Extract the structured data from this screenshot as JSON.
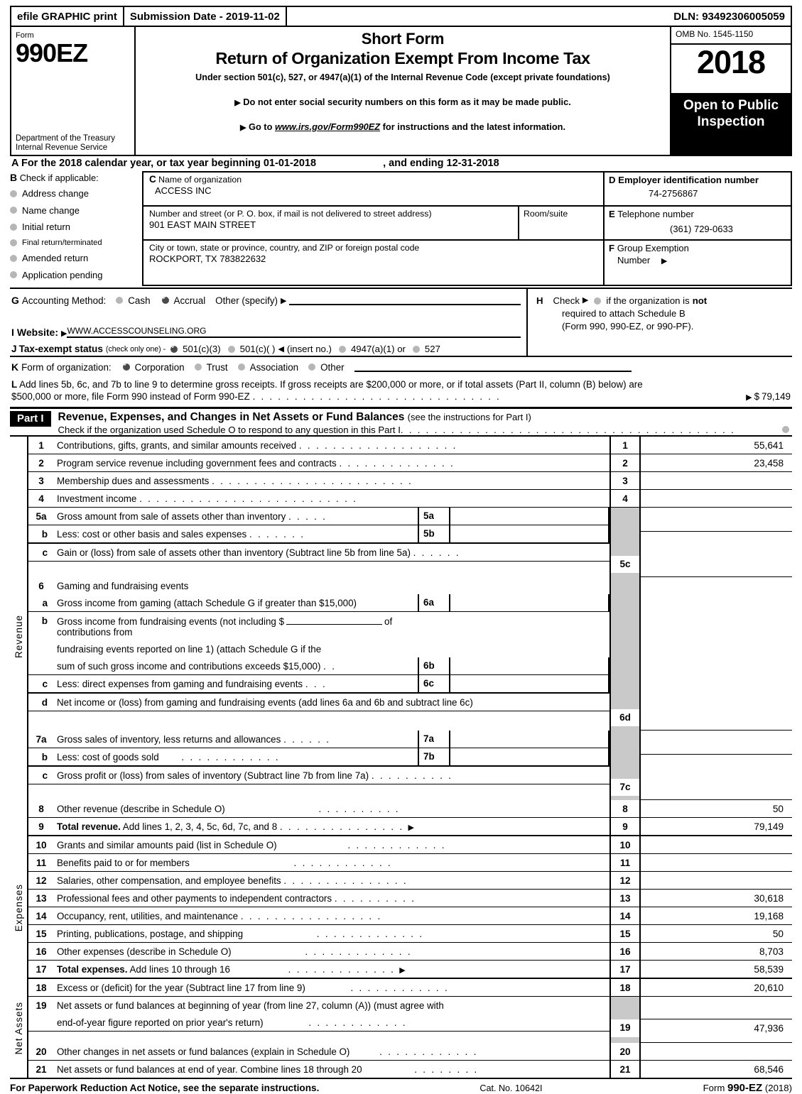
{
  "efile": {
    "graphic_print": "efile GRAPHIC print",
    "submission_date": "Submission Date - 2019-11-02",
    "dln": "DLN: 93492306005059"
  },
  "masthead": {
    "form_label": "Form",
    "form_number": "990EZ",
    "department": "Department of the Treasury Internal Revenue Service",
    "title_line1": "Short Form",
    "title_line2": "Return of Organization Exempt From Income Tax",
    "under_section": "Under section 501(c), 527, or 4947(a)(1) of the Internal Revenue Code (except private foundations)",
    "bullet1": "Do not enter social security numbers on this form as it may be made public.",
    "bullet2_pre": "Go to ",
    "bullet2_link": "www.irs.gov/Form990EZ",
    "bullet2_post": " for instructions and the latest information.",
    "omb": "OMB No. 1545-1150",
    "year": "2018",
    "open_to_public": "Open to Public Inspection"
  },
  "line_a": {
    "letter": "A",
    "text_pre": "For the 2018 calendar year, or tax year beginning",
    "begin_date": "01-01-2018",
    "text_mid": ", and ending",
    "end_date": "12-31-2018"
  },
  "section_b": {
    "letter": "B",
    "heading": "Check if applicable:",
    "items": [
      {
        "label": "Address change",
        "checked": false
      },
      {
        "label": "Name change",
        "checked": false
      },
      {
        "label": "Initial return",
        "checked": false
      },
      {
        "label": "Final return/terminated",
        "checked": false
      },
      {
        "label": "Amended return",
        "checked": false
      },
      {
        "label": "Application pending",
        "checked": false
      }
    ]
  },
  "section_c": {
    "letter": "C",
    "name_label": "Name of organization",
    "name_value": "ACCESS INC",
    "street_label": "Number and street (or P. O. box, if mail is not delivered to street address)",
    "street_value": "901 EAST MAIN STREET",
    "room_label": "Room/suite",
    "room_value": "",
    "city_label": "City or town, state or province, country, and ZIP or foreign postal code",
    "city_value": "ROCKPORT, TX   783822632"
  },
  "section_d": {
    "letter": "D",
    "label": "Employer identification number",
    "value": "74-2756867"
  },
  "section_e": {
    "letter": "E",
    "label": "Telephone number",
    "value": "(361) 729-0633"
  },
  "section_f": {
    "letter": "F",
    "label_line1": "Group Exemption",
    "label_line2": "Number",
    "value": ""
  },
  "section_g": {
    "letter": "G",
    "label": "Accounting Method:",
    "cash_label": "Cash",
    "cash_checked": false,
    "accrual_label": "Accrual",
    "accrual_checked": true,
    "other_label": "Other (specify)",
    "other_value": ""
  },
  "section_h": {
    "letter": "H",
    "text_pre": "Check",
    "checked": false,
    "text_line1": "if the organization is",
    "text_bold": "not",
    "text_line2": "required to attach Schedule B",
    "text_line3": "(Form 990, 990-EZ, or 990-PF)."
  },
  "section_i": {
    "letter": "I",
    "label": "Website:",
    "value": "WWW.ACCESSCOUNSELING.ORG"
  },
  "section_j": {
    "letter": "J",
    "label": "Tax-exempt status",
    "note": "(check only one) -",
    "options": [
      {
        "label": "501(c)(3)",
        "checked": true
      },
      {
        "label": "501(c)(  )",
        "checked": false
      },
      {
        "label": "4947(a)(1) or",
        "checked": false
      },
      {
        "label": "527",
        "checked": false
      }
    ],
    "insert_no": "(insert no.)"
  },
  "section_k": {
    "letter": "K",
    "label": "Form of organization:",
    "options": [
      {
        "label": "Corporation",
        "checked": true
      },
      {
        "label": "Trust",
        "checked": false
      },
      {
        "label": "Association",
        "checked": false
      },
      {
        "label": "Other",
        "checked": false
      }
    ]
  },
  "section_l": {
    "letter": "L",
    "text_line1": "Add lines 5b, 6c, and 7b to line 9 to determine gross receipts. If gross receipts are $200,000 or more, or if total assets (Part II, column (B) below) are",
    "text_line2": "$500,000 or more, file Form 990 instead of Form 990-EZ",
    "amount_prefix": "$",
    "amount": "79,149"
  },
  "part1": {
    "tag": "Part I",
    "title": "Revenue, Expenses, and Changes in Net Assets or Fund Balances",
    "title_note": "(see the instructions for Part I)",
    "schedule_o": "Check if the organization used Schedule O to respond to any question in this Part I",
    "schedule_o_checked": false
  },
  "sidebars": {
    "revenue": "Revenue",
    "expenses": "Expenses",
    "net_assets": "Net Assets"
  },
  "rows": {
    "r1": {
      "num": "1",
      "desc": "Contributions, gifts, grants, and similar amounts received",
      "code": "1",
      "amount": "55,641"
    },
    "r2": {
      "num": "2",
      "desc": "Program service revenue including government fees and contracts",
      "code": "2",
      "amount": "23,458"
    },
    "r3": {
      "num": "3",
      "desc": "Membership dues and assessments",
      "code": "3",
      "amount": ""
    },
    "r4": {
      "num": "4",
      "desc": "Investment income",
      "code": "4",
      "amount": ""
    },
    "r5a": {
      "num": "5a",
      "desc": "Gross amount from sale of assets other than inventory",
      "box": "5a",
      "amount": ""
    },
    "r5b": {
      "num": "b",
      "desc": "Less: cost or other basis and sales expenses",
      "box": "5b",
      "amount": ""
    },
    "r5c": {
      "num": "c",
      "desc": "Gain or (loss) from sale of assets other than inventory (Subtract line 5b from line 5a)",
      "code": "5c",
      "amount": ""
    },
    "r6": {
      "num": "6",
      "desc": "Gaming and fundraising events"
    },
    "r6a": {
      "num": "a",
      "desc": "Gross income from gaming (attach Schedule G if greater than $15,000)",
      "box": "6a",
      "amount": ""
    },
    "r6b": {
      "num": "b",
      "desc_l1_pre": "Gross income from fundraising events (not including $",
      "desc_l1_post": "of contributions from",
      "desc_l2": "fundraising events reported on line 1) (attach Schedule G if the",
      "desc_l3": "sum of such gross income and contributions exceeds $15,000)",
      "box": "6b",
      "amount": ""
    },
    "r6c": {
      "num": "c",
      "desc": "Less: direct expenses from gaming and fundraising events",
      "box": "6c",
      "amount": ""
    },
    "r6d": {
      "num": "d",
      "desc": "Net income or (loss) from gaming and fundraising events (add lines 6a and 6b and subtract line 6c)",
      "code": "6d",
      "amount": ""
    },
    "r7a": {
      "num": "7a",
      "desc": "Gross sales of inventory, less returns and allowances",
      "box": "7a",
      "amount": ""
    },
    "r7b": {
      "num": "b",
      "desc": "Less: cost of goods sold",
      "box": "7b",
      "amount": ""
    },
    "r7c": {
      "num": "c",
      "desc": "Gross profit or (loss) from sales of inventory (Subtract line 7b from line 7a)",
      "code": "7c",
      "amount": ""
    },
    "r8": {
      "num": "8",
      "desc": "Other revenue (describe in Schedule O)",
      "code": "8",
      "amount": "50"
    },
    "r9": {
      "num": "9",
      "desc_bold": "Total revenue.",
      "desc": "Add lines 1, 2, 3, 4, 5c, 6d, 7c, and 8",
      "code": "9",
      "amount": "79,149"
    },
    "r10": {
      "num": "10",
      "desc": "Grants and similar amounts paid (list in Schedule O)",
      "code": "10",
      "amount": ""
    },
    "r11": {
      "num": "11",
      "desc": "Benefits paid to or for members",
      "code": "11",
      "amount": ""
    },
    "r12": {
      "num": "12",
      "desc": "Salaries, other compensation, and employee benefits",
      "code": "12",
      "amount": ""
    },
    "r13": {
      "num": "13",
      "desc": "Professional fees and other payments to independent contractors",
      "code": "13",
      "amount": "30,618"
    },
    "r14": {
      "num": "14",
      "desc": "Occupancy, rent, utilities, and maintenance",
      "code": "14",
      "amount": "19,168"
    },
    "r15": {
      "num": "15",
      "desc": "Printing, publications, postage, and shipping",
      "code": "15",
      "amount": "50"
    },
    "r16": {
      "num": "16",
      "desc": "Other expenses (describe in Schedule O)",
      "code": "16",
      "amount": "8,703"
    },
    "r17": {
      "num": "17",
      "desc_bold": "Total expenses.",
      "desc": "Add lines 10 through 16",
      "code": "17",
      "amount": "58,539"
    },
    "r18": {
      "num": "18",
      "desc": "Excess or (deficit) for the year (Subtract line 17 from line 9)",
      "code": "18",
      "amount": "20,610"
    },
    "r19": {
      "num": "19",
      "desc_l1": "Net assets or fund balances at beginning of year (from line 27, column (A)) (must agree with",
      "desc_l2": "end-of-year figure reported on prior year's return)",
      "code": "19",
      "amount": "47,936"
    },
    "r20": {
      "num": "20",
      "desc": "Other changes in net assets or fund balances (explain in Schedule O)",
      "code": "20",
      "amount": ""
    },
    "r21": {
      "num": "21",
      "desc": "Net assets or fund balances at end of year. Combine lines 18 through 20",
      "code": "21",
      "amount": "68,546"
    }
  },
  "footer": {
    "notice": "For Paperwork Reduction Act Notice, see the separate instructions.",
    "cat_no": "Cat. No. 10642I",
    "form_pre": "Form ",
    "form_num": "990-EZ",
    "form_year": " (2018)"
  }
}
